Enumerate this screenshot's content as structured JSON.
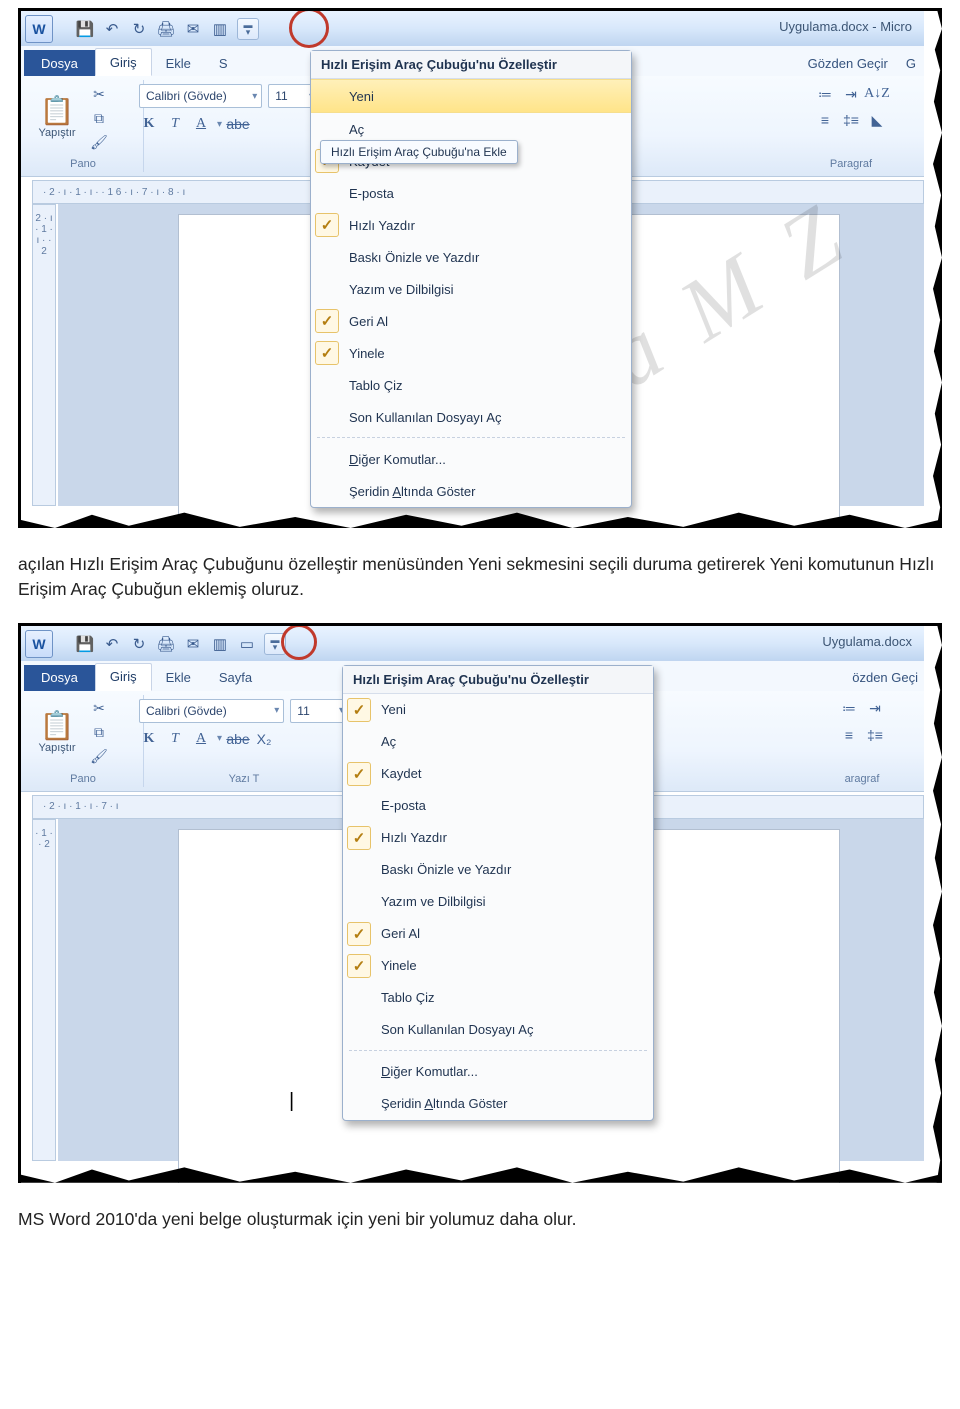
{
  "watermark_text": "stafa  M  Z",
  "shot1": {
    "window_title": "Uygulama.docx - Micro",
    "file_tab": "Dosya",
    "tabs": {
      "home": "Giriş",
      "insert": "Ekle",
      "page": "S",
      "review": "Gözden Geçir",
      "last": "G"
    },
    "paste_label": "Yapıştır",
    "group_clip": "Pano",
    "group_para": "Paragraf",
    "font_name": "Calibri (Gövde)",
    "font_size": "11",
    "ruler_h": " · 2 · ı · 1 · ı ·      · 1     6 · ı · 7 · ı · 8 · ı",
    "ruler_v": "2 · ı · 1 · ı ·     · 2",
    "tooltip": "Hızlı Erişim Araç Çubuğu'na Ekle",
    "dd": {
      "title": "Hızlı Erişim Araç Çubuğu'nu Özelleştir",
      "items": [
        {
          "label": "Yeni",
          "checked": false,
          "hl": true
        },
        {
          "label": "Aç",
          "checked": false,
          "hl": false
        },
        {
          "label": "Kaydet",
          "checked": true,
          "hl": false
        },
        {
          "label": "E-posta",
          "checked": false,
          "hl": false
        },
        {
          "label": "Hızlı Yazdır",
          "checked": true,
          "hl": false
        },
        {
          "label": "Baskı Önizle ve Yazdır",
          "checked": false,
          "hl": false
        },
        {
          "label": "Yazım ve Dilbilgisi",
          "checked": false,
          "hl": false
        },
        {
          "label": "Geri Al",
          "checked": true,
          "hl": false
        },
        {
          "label": "Yinele",
          "checked": true,
          "hl": false
        },
        {
          "label": "Tablo Çiz",
          "checked": false,
          "hl": false
        },
        {
          "label": "Son Kullanılan Dosyayı Aç",
          "checked": false,
          "hl": false
        }
      ],
      "footer": [
        "Diğer Komutlar...",
        "Şeridin Altında Göster"
      ]
    }
  },
  "caption1": "açılan Hızlı Erişim Araç Çubuğunu özelleştir menüsünden Yeni sekmesini seçili duruma getirerek Yeni komutunun Hızlı Erişim Araç Çubuğun eklemiş oluruz.",
  "shot2": {
    "window_title": "Uygulama.docx",
    "file_tab": "Dosya",
    "tabs": {
      "home": "Giriş",
      "insert": "Ekle",
      "page": "Sayfa",
      "review": "özden Geçi"
    },
    "paste_label": "Yapıştır",
    "group_clip": "Pano",
    "group_font": "Yazı T",
    "group_para": "aragraf",
    "font_name": "Calibri (Gövde)",
    "font_size": "11",
    "ruler_h": " · 2 · ı · 1 · ı ·     7 · ı",
    "ruler_v": " · 1 ·    · 2",
    "dd": {
      "title": "Hızlı Erişim Araç Çubuğu'nu Özelleştir",
      "items": [
        {
          "label": "Yeni",
          "checked": true,
          "hl": false
        },
        {
          "label": "Aç",
          "checked": false,
          "hl": false
        },
        {
          "label": "Kaydet",
          "checked": true,
          "hl": false
        },
        {
          "label": "E-posta",
          "checked": false,
          "hl": false
        },
        {
          "label": "Hızlı Yazdır",
          "checked": true,
          "hl": false
        },
        {
          "label": "Baskı Önizle ve Yazdır",
          "checked": false,
          "hl": false
        },
        {
          "label": "Yazım ve Dilbilgisi",
          "checked": false,
          "hl": false
        },
        {
          "label": "Geri Al",
          "checked": true,
          "hl": false
        },
        {
          "label": "Yinele",
          "checked": true,
          "hl": false
        },
        {
          "label": "Tablo Çiz",
          "checked": false,
          "hl": false
        },
        {
          "label": "Son Kullanılan Dosyayı Aç",
          "checked": false,
          "hl": false
        }
      ],
      "footer": [
        "Diğer Komutlar...",
        "Şeridin Altında Göster"
      ]
    }
  },
  "caption2": "MS Word 2010'da yeni belge oluşturmak için yeni bir yolumuz daha olur."
}
